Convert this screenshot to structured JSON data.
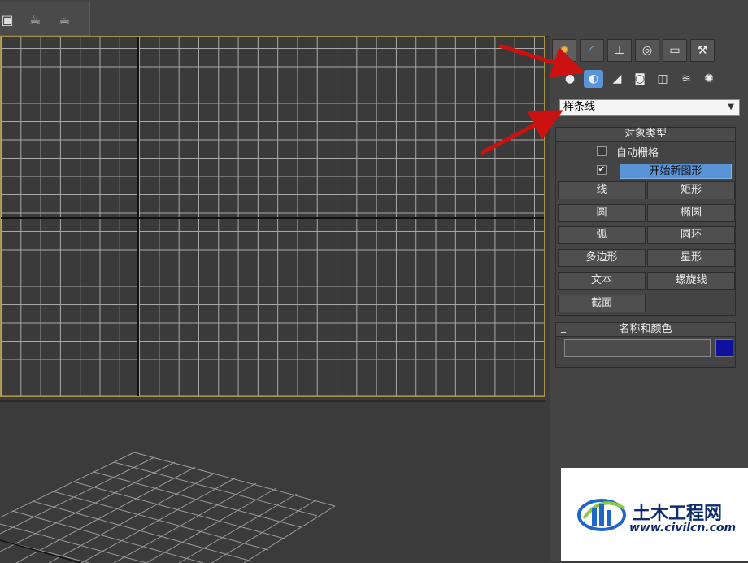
{
  "toolbar": {
    "icons": [
      "render-setup-icon",
      "render-frame-icon",
      "render-production-icon"
    ]
  },
  "command_panel": {
    "tabs": [
      "create-tab",
      "modify-tab",
      "hierarchy-tab",
      "motion-tab",
      "display-tab",
      "utilities-tab"
    ],
    "create_categories": [
      "geometry",
      "shapes",
      "lights",
      "cameras",
      "helpers",
      "space-warps",
      "systems"
    ],
    "dropdown_value": "样条线",
    "object_type": {
      "title": "对象类型",
      "auto_grid": {
        "label": "自动栅格",
        "checked": false
      },
      "start_new_shape": {
        "label": "开始新图形",
        "checked": true
      },
      "buttons": [
        {
          "label": "线"
        },
        {
          "label": "矩形"
        },
        {
          "label": "圆"
        },
        {
          "label": "椭圆"
        },
        {
          "label": "弧"
        },
        {
          "label": "圆环"
        },
        {
          "label": "多边形"
        },
        {
          "label": "星形"
        },
        {
          "label": "文本"
        },
        {
          "label": "螺旋线"
        },
        {
          "label": "截面"
        }
      ]
    },
    "name_and_color": {
      "title": "名称和颜色",
      "name_value": "",
      "color": "#1010a0"
    }
  },
  "colors": {
    "viewport_border_active": "#a7924a",
    "annotation_arrow": "#cc1111",
    "start_new_shape_highlight": "#5a94d8"
  },
  "watermark": {
    "name": "土木工程网",
    "url": "www.civilcn.com"
  }
}
